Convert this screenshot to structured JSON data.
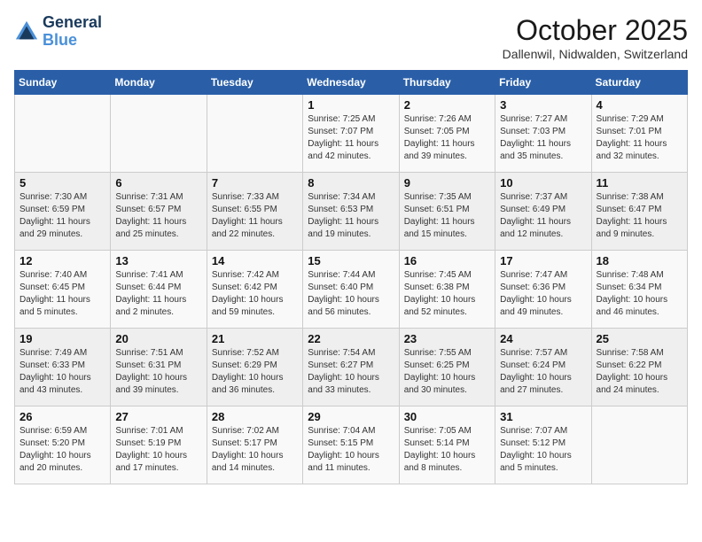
{
  "header": {
    "logo_line1": "General",
    "logo_line2": "Blue",
    "month": "October 2025",
    "location": "Dallenwil, Nidwalden, Switzerland"
  },
  "days_of_week": [
    "Sunday",
    "Monday",
    "Tuesday",
    "Wednesday",
    "Thursday",
    "Friday",
    "Saturday"
  ],
  "weeks": [
    [
      {
        "num": "",
        "info": ""
      },
      {
        "num": "",
        "info": ""
      },
      {
        "num": "",
        "info": ""
      },
      {
        "num": "1",
        "info": "Sunrise: 7:25 AM\nSunset: 7:07 PM\nDaylight: 11 hours\nand 42 minutes."
      },
      {
        "num": "2",
        "info": "Sunrise: 7:26 AM\nSunset: 7:05 PM\nDaylight: 11 hours\nand 39 minutes."
      },
      {
        "num": "3",
        "info": "Sunrise: 7:27 AM\nSunset: 7:03 PM\nDaylight: 11 hours\nand 35 minutes."
      },
      {
        "num": "4",
        "info": "Sunrise: 7:29 AM\nSunset: 7:01 PM\nDaylight: 11 hours\nand 32 minutes."
      }
    ],
    [
      {
        "num": "5",
        "info": "Sunrise: 7:30 AM\nSunset: 6:59 PM\nDaylight: 11 hours\nand 29 minutes."
      },
      {
        "num": "6",
        "info": "Sunrise: 7:31 AM\nSunset: 6:57 PM\nDaylight: 11 hours\nand 25 minutes."
      },
      {
        "num": "7",
        "info": "Sunrise: 7:33 AM\nSunset: 6:55 PM\nDaylight: 11 hours\nand 22 minutes."
      },
      {
        "num": "8",
        "info": "Sunrise: 7:34 AM\nSunset: 6:53 PM\nDaylight: 11 hours\nand 19 minutes."
      },
      {
        "num": "9",
        "info": "Sunrise: 7:35 AM\nSunset: 6:51 PM\nDaylight: 11 hours\nand 15 minutes."
      },
      {
        "num": "10",
        "info": "Sunrise: 7:37 AM\nSunset: 6:49 PM\nDaylight: 11 hours\nand 12 minutes."
      },
      {
        "num": "11",
        "info": "Sunrise: 7:38 AM\nSunset: 6:47 PM\nDaylight: 11 hours\nand 9 minutes."
      }
    ],
    [
      {
        "num": "12",
        "info": "Sunrise: 7:40 AM\nSunset: 6:45 PM\nDaylight: 11 hours\nand 5 minutes."
      },
      {
        "num": "13",
        "info": "Sunrise: 7:41 AM\nSunset: 6:44 PM\nDaylight: 11 hours\nand 2 minutes."
      },
      {
        "num": "14",
        "info": "Sunrise: 7:42 AM\nSunset: 6:42 PM\nDaylight: 10 hours\nand 59 minutes."
      },
      {
        "num": "15",
        "info": "Sunrise: 7:44 AM\nSunset: 6:40 PM\nDaylight: 10 hours\nand 56 minutes."
      },
      {
        "num": "16",
        "info": "Sunrise: 7:45 AM\nSunset: 6:38 PM\nDaylight: 10 hours\nand 52 minutes."
      },
      {
        "num": "17",
        "info": "Sunrise: 7:47 AM\nSunset: 6:36 PM\nDaylight: 10 hours\nand 49 minutes."
      },
      {
        "num": "18",
        "info": "Sunrise: 7:48 AM\nSunset: 6:34 PM\nDaylight: 10 hours\nand 46 minutes."
      }
    ],
    [
      {
        "num": "19",
        "info": "Sunrise: 7:49 AM\nSunset: 6:33 PM\nDaylight: 10 hours\nand 43 minutes."
      },
      {
        "num": "20",
        "info": "Sunrise: 7:51 AM\nSunset: 6:31 PM\nDaylight: 10 hours\nand 39 minutes."
      },
      {
        "num": "21",
        "info": "Sunrise: 7:52 AM\nSunset: 6:29 PM\nDaylight: 10 hours\nand 36 minutes."
      },
      {
        "num": "22",
        "info": "Sunrise: 7:54 AM\nSunset: 6:27 PM\nDaylight: 10 hours\nand 33 minutes."
      },
      {
        "num": "23",
        "info": "Sunrise: 7:55 AM\nSunset: 6:25 PM\nDaylight: 10 hours\nand 30 minutes."
      },
      {
        "num": "24",
        "info": "Sunrise: 7:57 AM\nSunset: 6:24 PM\nDaylight: 10 hours\nand 27 minutes."
      },
      {
        "num": "25",
        "info": "Sunrise: 7:58 AM\nSunset: 6:22 PM\nDaylight: 10 hours\nand 24 minutes."
      }
    ],
    [
      {
        "num": "26",
        "info": "Sunrise: 6:59 AM\nSunset: 5:20 PM\nDaylight: 10 hours\nand 20 minutes."
      },
      {
        "num": "27",
        "info": "Sunrise: 7:01 AM\nSunset: 5:19 PM\nDaylight: 10 hours\nand 17 minutes."
      },
      {
        "num": "28",
        "info": "Sunrise: 7:02 AM\nSunset: 5:17 PM\nDaylight: 10 hours\nand 14 minutes."
      },
      {
        "num": "29",
        "info": "Sunrise: 7:04 AM\nSunset: 5:15 PM\nDaylight: 10 hours\nand 11 minutes."
      },
      {
        "num": "30",
        "info": "Sunrise: 7:05 AM\nSunset: 5:14 PM\nDaylight: 10 hours\nand 8 minutes."
      },
      {
        "num": "31",
        "info": "Sunrise: 7:07 AM\nSunset: 5:12 PM\nDaylight: 10 hours\nand 5 minutes."
      },
      {
        "num": "",
        "info": ""
      }
    ]
  ]
}
